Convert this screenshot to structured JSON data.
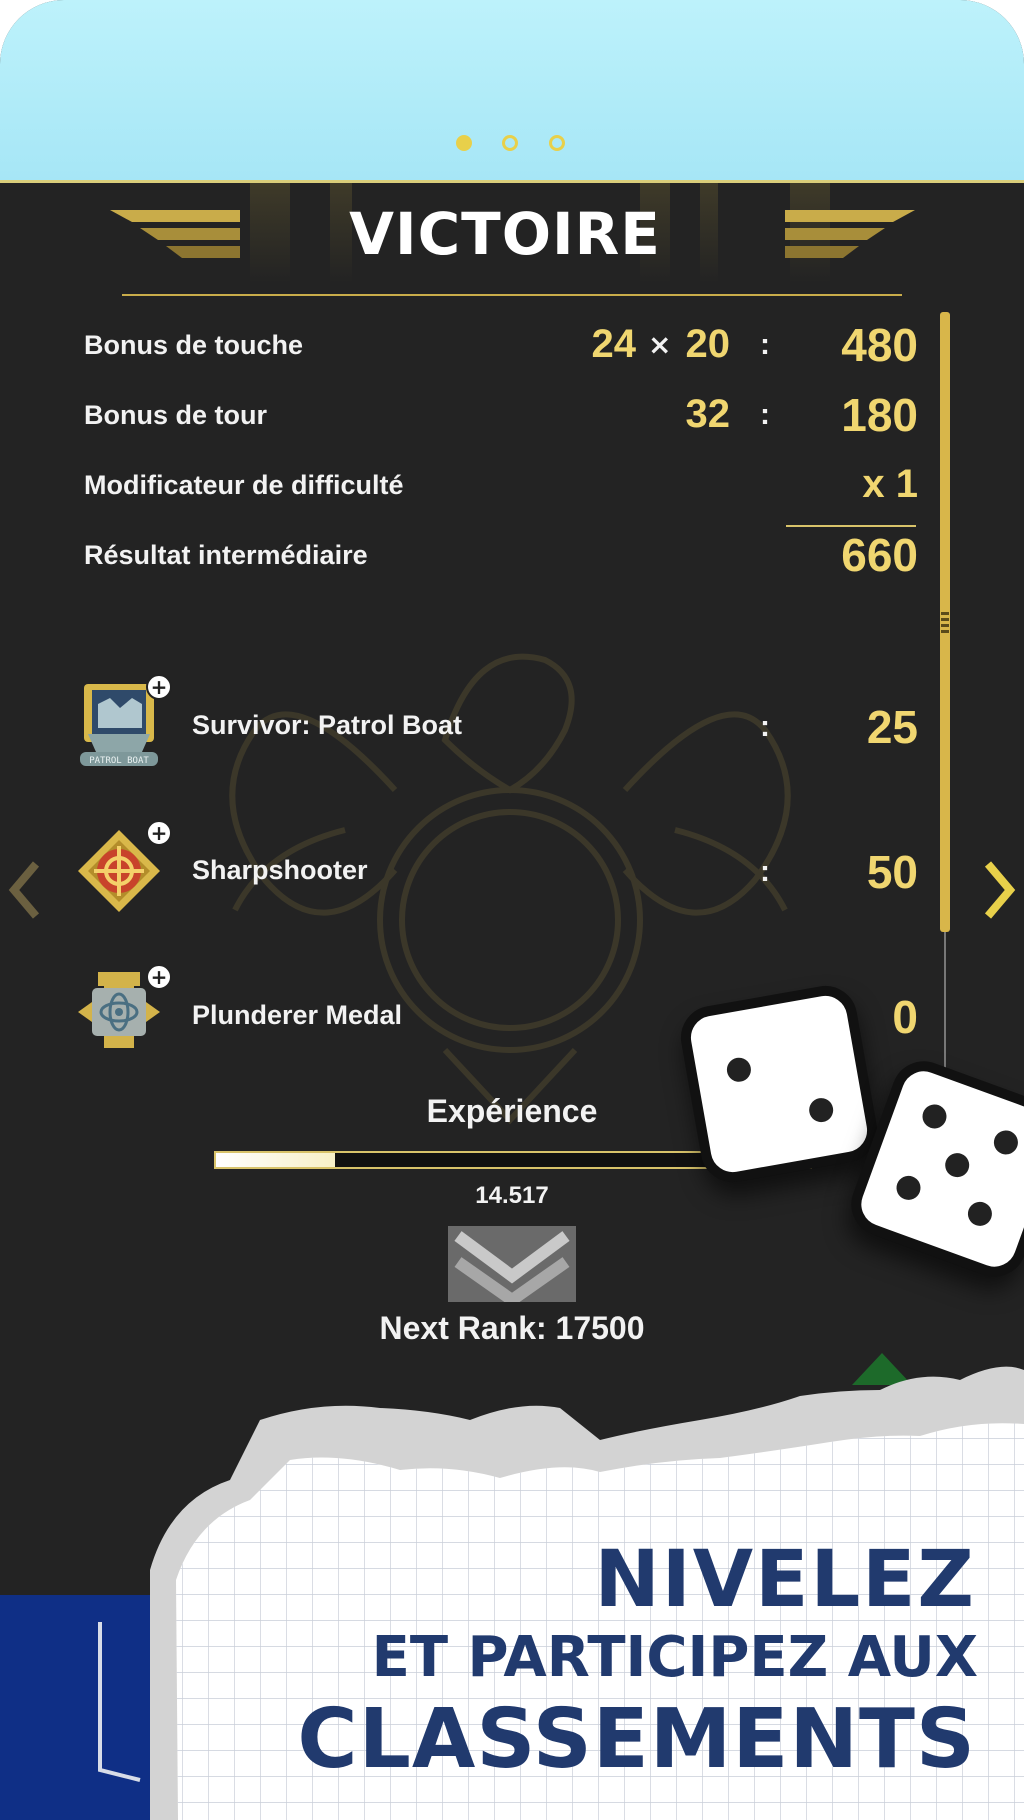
{
  "carousel": {
    "pages": 3,
    "active_page": 1
  },
  "screen": {
    "title": "VICTOIRE",
    "score_rows": [
      {
        "label": "Bonus de touche",
        "count": "24",
        "times": "×",
        "multiplier": "20",
        "sep": ":",
        "value": "480"
      },
      {
        "label": "Bonus de tour",
        "count": "32",
        "sep": ":",
        "value": "180"
      },
      {
        "label": "Modificateur de difficulté",
        "value": "x 1"
      },
      {
        "label": "Résultat intermédiaire",
        "value": "660"
      }
    ],
    "achievements": [
      {
        "name": "Survivor: Patrol Boat",
        "sep": ":",
        "value": "25",
        "icon": "patrol-boat-medal-icon",
        "badge_text": "PATROL BOAT"
      },
      {
        "name": "Sharpshooter",
        "sep": ":",
        "value": "50",
        "icon": "sharpshooter-medal-icon"
      },
      {
        "name": "Plunderer Medal",
        "value": "0",
        "icon": "plunderer-medal-icon"
      }
    ],
    "experience": {
      "label": "Expérience",
      "value": "14.517",
      "progress": 0.2,
      "next_rank": "Next Rank: 17500"
    }
  },
  "promo": {
    "line1": "NIVELEZ",
    "line2": "ET PARTICIPEZ AUX",
    "line3": "CLASSEMENTS"
  },
  "colors": {
    "accent_gold": "#f0d670",
    "panel_bg": "#232323",
    "sky": "#a6e6f6",
    "headline_navy": "#213a6e"
  }
}
